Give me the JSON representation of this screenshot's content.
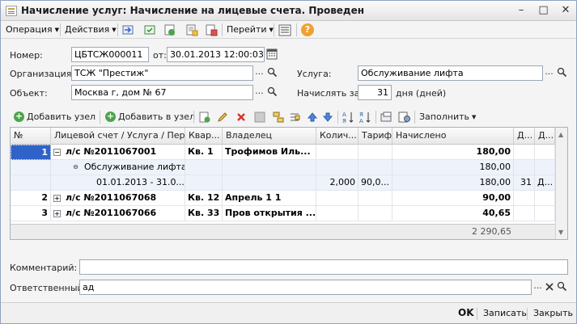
{
  "window": {
    "title": "Начисление услуг: Начисление на лицевые счета. Проведен",
    "minimize": "–",
    "maximize": "□",
    "close": "✕"
  },
  "toolbar": {
    "operation": "Операция",
    "actions": "Действия",
    "goto": "Перейти",
    "help": "?"
  },
  "form": {
    "number_label": "Номер:",
    "number_value": "ЦБТСЖ000011",
    "from_label": "от:",
    "date_value": "30.01.2013 12:00:03",
    "org_label": "Организация:",
    "org_value": "ТСЖ \"Престиж\"",
    "object_label": "Объект:",
    "object_value": "Москва г, дом № 67",
    "service_label": "Услуга:",
    "service_value": "Обслуживание лифта",
    "charge_label": "Начислять за:",
    "charge_days": "31",
    "charge_unit": "дня (дней)"
  },
  "grid_toolbar": {
    "add_node": "Добавить узел",
    "add_in_node": "Добавить в узел",
    "fill": "Заполнить"
  },
  "grid": {
    "columns": {
      "num": "№",
      "account": "Лицевой счет / Услуга / Пер...",
      "flat": "Квар...",
      "owner": "Владелец",
      "qty": "Колич...",
      "tariff": "Тариф",
      "charged": "Начислено",
      "d1": "Д...",
      "d2": "Д..."
    },
    "rows": [
      {
        "num": "1",
        "account": "л/с №2011067001",
        "flat": "Кв. 1",
        "owner": "Трофимов Иль...",
        "qty": "",
        "tariff": "",
        "charged": "180,00",
        "d1": "",
        "d2": ""
      },
      {
        "num": "",
        "account": "Обслуживание лифта",
        "flat": "",
        "owner": "",
        "qty": "",
        "tariff": "",
        "charged": "180,00",
        "d1": "",
        "d2": ""
      },
      {
        "num": "",
        "account": "01.01.2013 - 31.0...",
        "flat": "",
        "owner": "",
        "qty": "2,000",
        "tariff": "90,0...",
        "charged": "180,00",
        "d1": "31",
        "d2": "Д..."
      },
      {
        "num": "2",
        "account": "л/с №2011067068",
        "flat": "Кв. 12",
        "owner": "Апрель 1 1",
        "qty": "",
        "tariff": "",
        "charged": "90,00",
        "d1": "",
        "d2": ""
      },
      {
        "num": "3",
        "account": "л/с №2011067066",
        "flat": "Кв. 33",
        "owner": "Пров открытия ...",
        "qty": "",
        "tariff": "",
        "charged": "40,65",
        "d1": "",
        "d2": ""
      }
    ],
    "total": "2 290,65"
  },
  "bottom": {
    "comment_label": "Комментарий:",
    "comment_value": "",
    "resp_label": "Ответственный:",
    "resp_value": "ад"
  },
  "statusbar": {
    "ok": "OK",
    "save": "Записать",
    "close": "Закрыть"
  },
  "colors": {
    "selection": "#2f63c9",
    "group_row": "#eef3fb"
  }
}
